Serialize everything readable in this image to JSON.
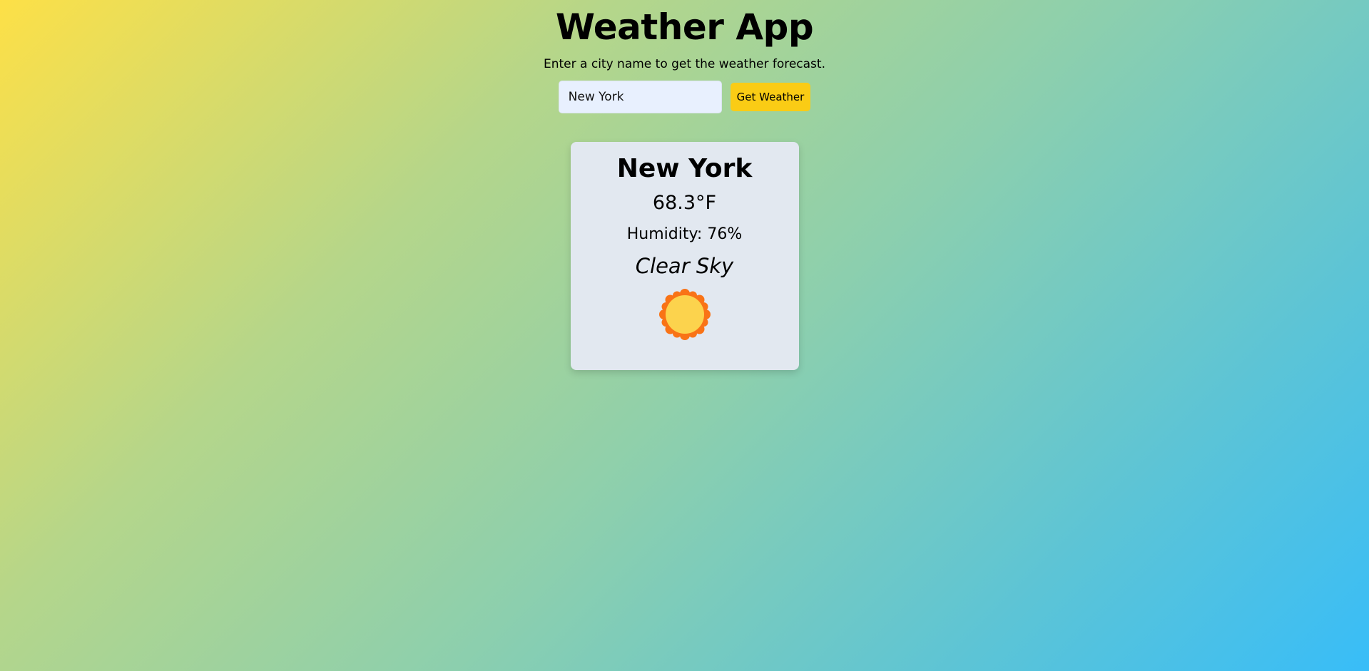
{
  "app": {
    "title": "Weather App",
    "subtitle": "Enter a city name to get the weather forecast."
  },
  "search": {
    "value": "New York",
    "button_label": "Get Weather"
  },
  "weather": {
    "city": "New York",
    "temperature": "68.3°F",
    "humidity": "Humidity: 76%",
    "description": "Clear Sky",
    "icon": "sun-icon"
  },
  "colors": {
    "accent": "#facc15",
    "card_bg": "#e2e8f0",
    "input_bg": "#e8f0fe",
    "sun_fill": "#fcd34d",
    "sun_rays": "#f97316",
    "gradient_start": "#fde047",
    "gradient_end": "#38bdf8"
  }
}
